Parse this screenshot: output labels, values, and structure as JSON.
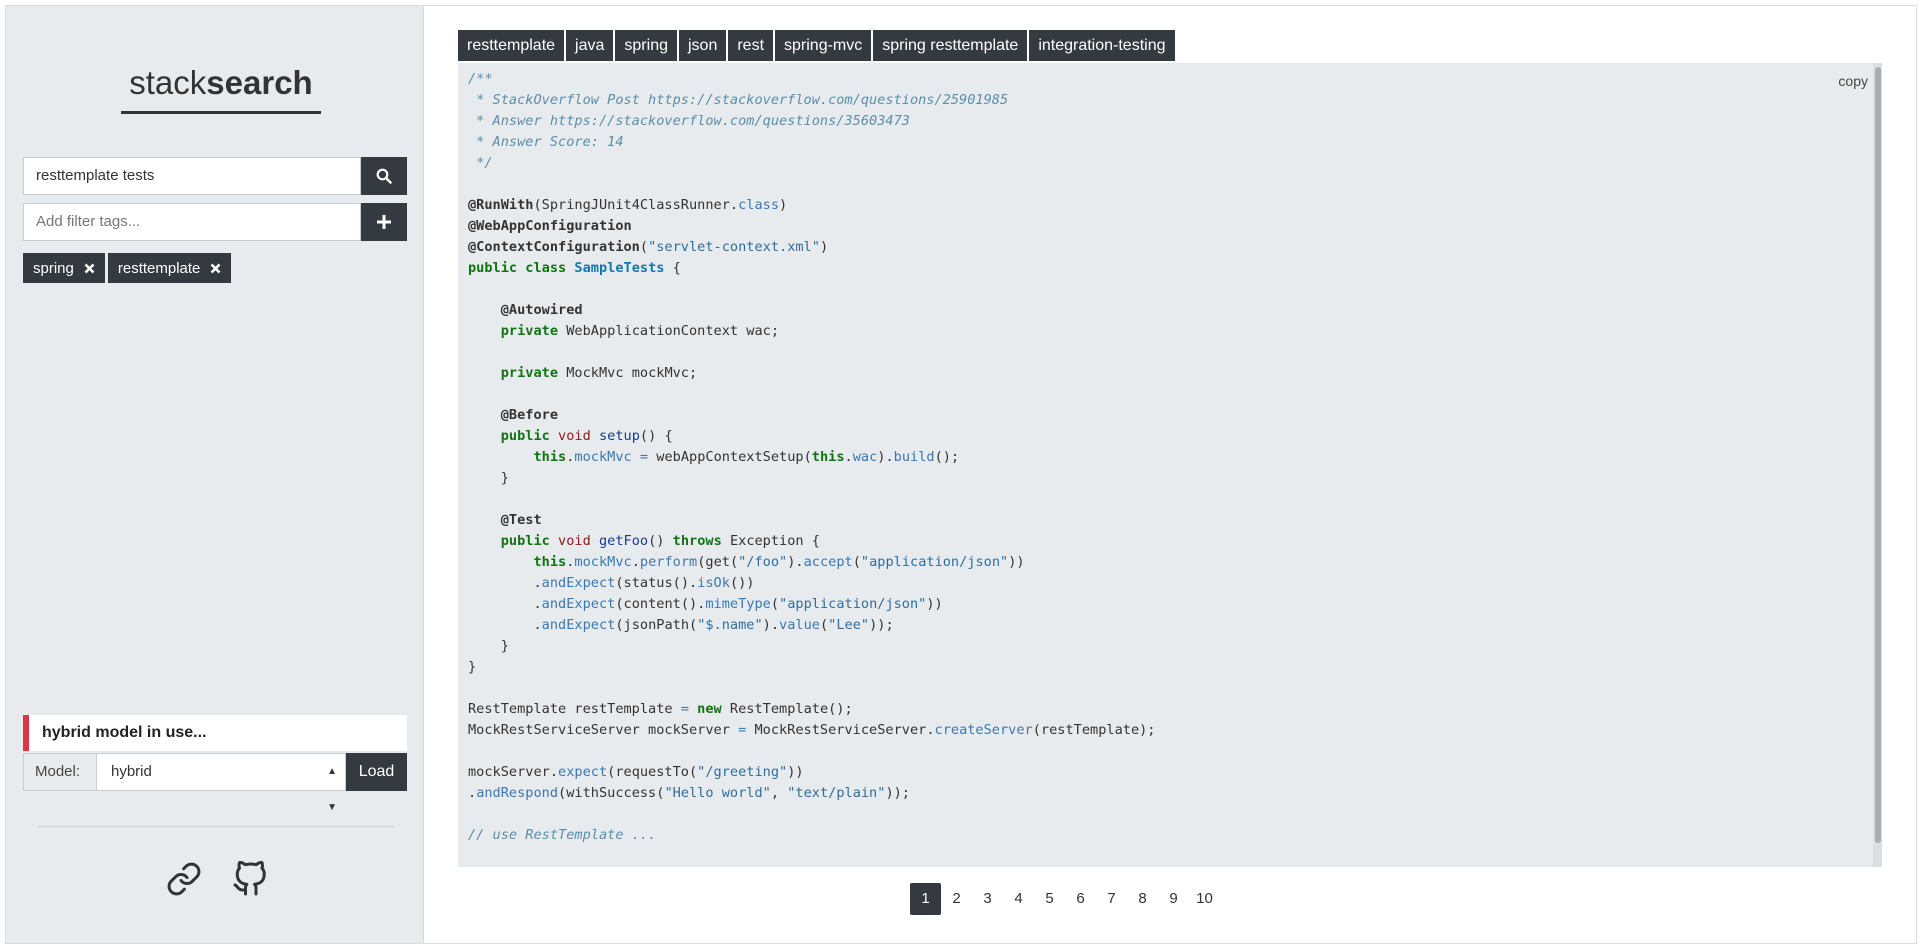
{
  "sidebar": {
    "brand_light": "stack",
    "brand_bold": "search",
    "search": {
      "value": "resttemplate tests"
    },
    "filter": {
      "placeholder": "Add filter tags..."
    },
    "active_tags": [
      {
        "label": "spring"
      },
      {
        "label": "resttemplate"
      }
    ],
    "status_message": "hybrid model in use...",
    "model": {
      "label": "Model:",
      "value": "hybrid",
      "load_label": "Load"
    },
    "footer_icons": [
      "link-icon",
      "github-icon"
    ]
  },
  "result": {
    "tags": [
      "resttemplate",
      "java",
      "spring",
      "json",
      "rest",
      "spring-mvc",
      "spring resttemplate",
      "integration-testing"
    ],
    "copy_label": "copy",
    "code": "/**\n * StackOverflow Post https://stackoverflow.com/questions/25901985\n * Answer https://stackoverflow.com/questions/35603473\n * Answer Score: 14\n */\n\n@RunWith(SpringJUnit4ClassRunner.class)\n@WebAppConfiguration\n@ContextConfiguration(\"servlet-context.xml\")\npublic class SampleTests {\n\n    @Autowired\n    private WebApplicationContext wac;\n\n    private MockMvc mockMvc;\n\n    @Before\n    public void setup() {\n        this.mockMvc = webAppContextSetup(this.wac).build();\n    }\n\n    @Test\n    public void getFoo() throws Exception {\n        this.mockMvc.perform(get(\"/foo\").accept(\"application/json\"))\n        .andExpect(status().isOk())\n        .andExpect(content().mimeType(\"application/json\"))\n        .andExpect(jsonPath(\"$.name\").value(\"Lee\"));\n    }\n}\n\nRestTemplate restTemplate = new RestTemplate();\nMockRestServiceServer mockServer = MockRestServiceServer.createServer(restTemplate);\n\nmockServer.expect(requestTo(\"/greeting\"))\n.andRespond(withSuccess(\"Hello world\", \"text/plain\"));\n\n// use RestTemplate ..."
  },
  "pagination": {
    "pages": [
      "1",
      "2",
      "3",
      "4",
      "5",
      "6",
      "7",
      "8",
      "9",
      "10"
    ],
    "current": "1"
  },
  "colors": {
    "dark": "#343a40",
    "sidebar_bg": "#e8ebee",
    "status_accent": "#dc3545"
  }
}
